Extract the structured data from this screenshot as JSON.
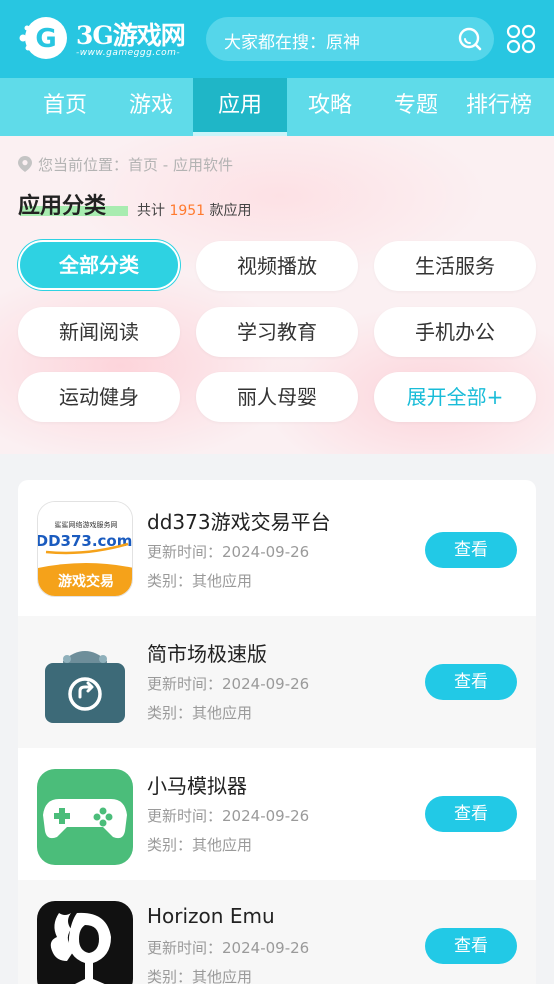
{
  "header": {
    "logo_title": "3G游戏网",
    "logo_sub": "-www.gameggg.com-",
    "search_placeholder": "大家都在搜：原神",
    "search_icon": "search-icon",
    "apps_icon": "apps-grid-icon"
  },
  "nav": {
    "items": [
      {
        "label": "首页"
      },
      {
        "label": "游戏"
      },
      {
        "label": "应用"
      },
      {
        "label": "攻略"
      },
      {
        "label": "专题"
      },
      {
        "label": "排行榜"
      }
    ],
    "active_index": 2
  },
  "breadcrumb": {
    "prefix": "您当前位置：",
    "home": "首页",
    "sep": " - ",
    "current": "应用软件"
  },
  "category": {
    "title": "应用分类",
    "count_prefix": "共计",
    "count": "1951",
    "count_suffix": "款应用",
    "chips": [
      {
        "label": "全部分类"
      },
      {
        "label": "视频播放"
      },
      {
        "label": "生活服务"
      },
      {
        "label": "新闻阅读"
      },
      {
        "label": "学习教育"
      },
      {
        "label": "手机办公"
      },
      {
        "label": "运动健身"
      },
      {
        "label": "丽人母婴"
      },
      {
        "label": "展开全部+"
      }
    ]
  },
  "apps": [
    {
      "name": "dd373游戏交易平台",
      "update_label": "更新时间：",
      "update": "2024-09-26",
      "cat_label": "类别：",
      "cat": "其他应用",
      "button": "查看",
      "icon_top": "鲨鲨网络游戏服务网",
      "icon_brand": "DD373.com",
      "icon_band": "游戏交易"
    },
    {
      "name": "简市场极速版",
      "update_label": "更新时间：",
      "update": "2024-09-26",
      "cat_label": "类别：",
      "cat": "其他应用",
      "button": "查看"
    },
    {
      "name": "小马模拟器",
      "update_label": "更新时间：",
      "update": "2024-09-26",
      "cat_label": "类别：",
      "cat": "其他应用",
      "button": "查看"
    },
    {
      "name": "Horizon Emu",
      "update_label": "更新时间：",
      "update": "2024-09-26",
      "cat_label": "类别：",
      "cat": "其他应用",
      "button": "查看"
    }
  ],
  "colors": {
    "brand": "#28c6e1",
    "nav_bg": "#5fdbe9",
    "nav_active": "#1fb6c7",
    "button": "#22c9e6",
    "count_accent": "#ff7a2e"
  }
}
